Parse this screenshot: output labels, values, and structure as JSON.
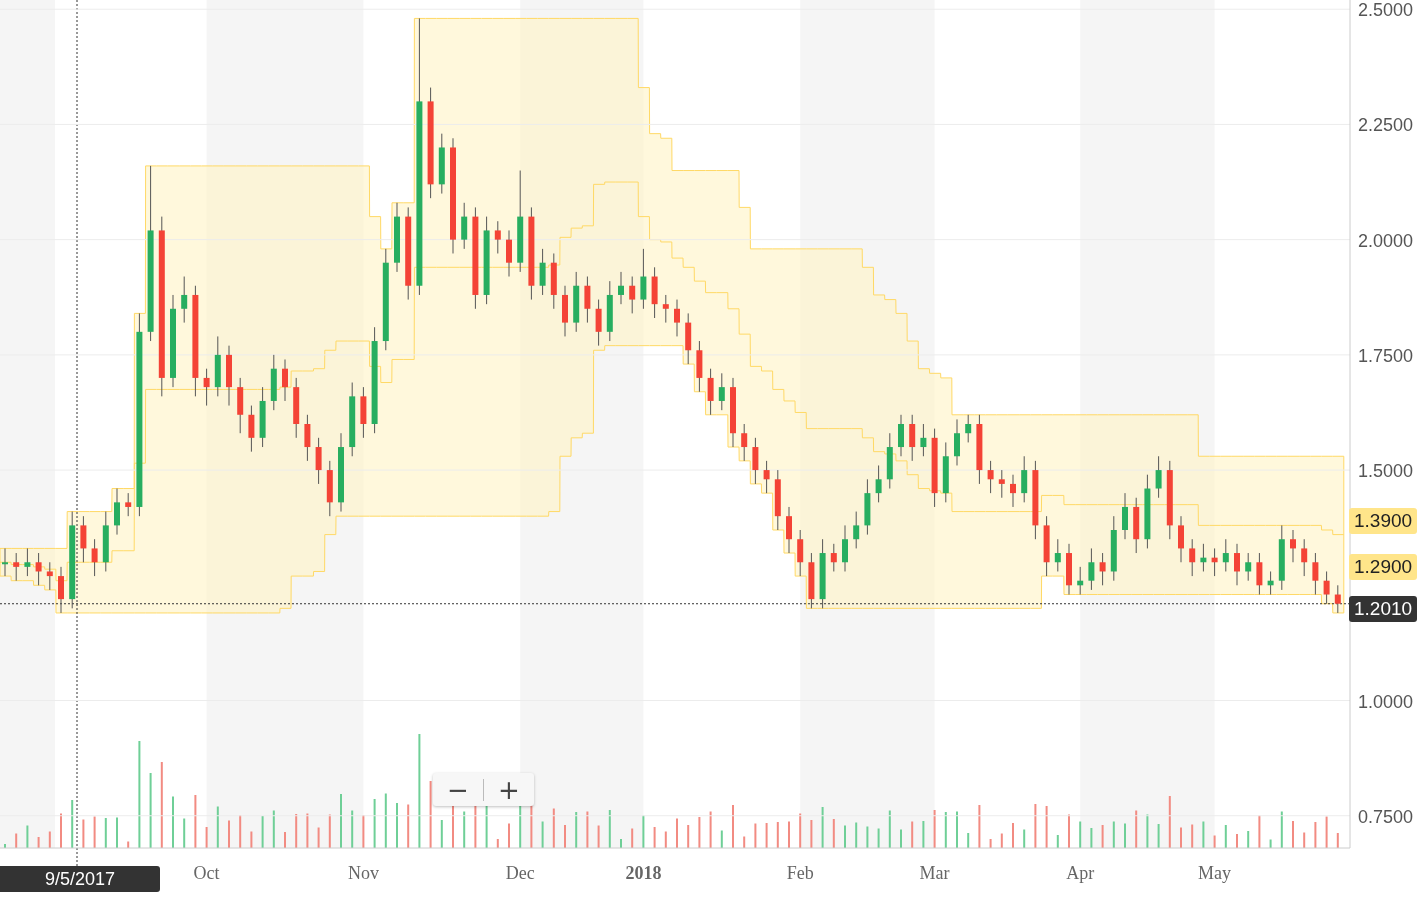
{
  "chart": {
    "chart_data": {
      "type": "candlestick",
      "ylim": [
        0.68,
        2.52
      ],
      "grid": true,
      "yticks": [
        {
          "value": 0.75,
          "label": "0.7500"
        },
        {
          "value": 1.0,
          "label": "1.0000"
        },
        {
          "value": 1.5,
          "label": "1.5000"
        },
        {
          "value": 1.75,
          "label": "1.7500"
        },
        {
          "value": 2.0,
          "label": "2.0000"
        },
        {
          "value": 2.25,
          "label": "2.2500"
        },
        {
          "value": 2.5,
          "label": "2.5000"
        }
      ],
      "categories": [
        null,
        null,
        null,
        null,
        null,
        null,
        null,
        null,
        null,
        null,
        null,
        null,
        null,
        null,
        null,
        null,
        null,
        null,
        "Oct",
        null,
        null,
        null,
        null,
        null,
        null,
        null,
        null,
        null,
        null,
        null,
        null,
        null,
        "Nov",
        null,
        null,
        null,
        null,
        null,
        null,
        null,
        null,
        null,
        null,
        null,
        null,
        null,
        "Dec",
        null,
        null,
        null,
        null,
        null,
        null,
        null,
        null,
        null,
        null,
        "2018",
        null,
        null,
        null,
        null,
        null,
        null,
        null,
        null,
        null,
        null,
        null,
        null,
        null,
        "Feb",
        null,
        null,
        null,
        null,
        null,
        null,
        null,
        null,
        null,
        null,
        null,
        "Mar",
        null,
        null,
        null,
        null,
        null,
        null,
        null,
        null,
        null,
        null,
        null,
        null,
        "Apr",
        null,
        null,
        null,
        null,
        null,
        null,
        null,
        null,
        null,
        null,
        null,
        "May",
        null,
        null,
        null,
        null,
        null,
        null,
        null,
        null,
        null,
        null,
        null
      ],
      "ohlc": [
        [
          1.3,
          1.33,
          1.27,
          1.3
        ],
        [
          1.3,
          1.32,
          1.26,
          1.29
        ],
        [
          1.29,
          1.33,
          1.27,
          1.3
        ],
        [
          1.3,
          1.32,
          1.25,
          1.28
        ],
        [
          1.28,
          1.3,
          1.24,
          1.27
        ],
        [
          1.27,
          1.29,
          1.19,
          1.22
        ],
        [
          1.22,
          1.41,
          1.2,
          1.38
        ],
        [
          1.38,
          1.4,
          1.3,
          1.33
        ],
        [
          1.33,
          1.35,
          1.27,
          1.3
        ],
        [
          1.3,
          1.41,
          1.28,
          1.38
        ],
        [
          1.38,
          1.46,
          1.36,
          1.43
        ],
        [
          1.43,
          1.45,
          1.4,
          1.42
        ],
        [
          1.42,
          1.84,
          1.4,
          1.8
        ],
        [
          1.8,
          2.16,
          1.78,
          2.02
        ],
        [
          2.02,
          2.05,
          1.66,
          1.7
        ],
        [
          1.7,
          1.88,
          1.68,
          1.85
        ],
        [
          1.85,
          1.92,
          1.82,
          1.88
        ],
        [
          1.88,
          1.9,
          1.66,
          1.7
        ],
        [
          1.7,
          1.72,
          1.64,
          1.68
        ],
        [
          1.68,
          1.79,
          1.66,
          1.75
        ],
        [
          1.75,
          1.77,
          1.64,
          1.68
        ],
        [
          1.68,
          1.7,
          1.58,
          1.62
        ],
        [
          1.62,
          1.64,
          1.54,
          1.57
        ],
        [
          1.57,
          1.68,
          1.55,
          1.65
        ],
        [
          1.65,
          1.75,
          1.63,
          1.72
        ],
        [
          1.72,
          1.74,
          1.65,
          1.68
        ],
        [
          1.68,
          1.7,
          1.57,
          1.6
        ],
        [
          1.6,
          1.62,
          1.52,
          1.55
        ],
        [
          1.55,
          1.57,
          1.47,
          1.5
        ],
        [
          1.5,
          1.52,
          1.4,
          1.43
        ],
        [
          1.43,
          1.58,
          1.41,
          1.55
        ],
        [
          1.55,
          1.69,
          1.53,
          1.66
        ],
        [
          1.66,
          1.68,
          1.57,
          1.6
        ],
        [
          1.6,
          1.81,
          1.58,
          1.78
        ],
        [
          1.78,
          1.98,
          1.76,
          1.95
        ],
        [
          1.95,
          2.08,
          1.93,
          2.05
        ],
        [
          2.05,
          2.07,
          1.87,
          1.9
        ],
        [
          1.9,
          2.48,
          1.88,
          2.3
        ],
        [
          2.3,
          2.33,
          2.09,
          2.12
        ],
        [
          2.12,
          2.23,
          2.1,
          2.2
        ],
        [
          2.2,
          2.22,
          1.97,
          2.0
        ],
        [
          2.0,
          2.08,
          1.98,
          2.05
        ],
        [
          2.05,
          2.07,
          1.85,
          1.88
        ],
        [
          1.88,
          2.05,
          1.86,
          2.02
        ],
        [
          2.02,
          2.04,
          1.97,
          2.0
        ],
        [
          2.0,
          2.02,
          1.92,
          1.95
        ],
        [
          1.95,
          2.15,
          1.93,
          2.05
        ],
        [
          2.05,
          2.07,
          1.87,
          1.9
        ],
        [
          1.9,
          1.98,
          1.88,
          1.95
        ],
        [
          1.95,
          1.97,
          1.85,
          1.88
        ],
        [
          1.88,
          1.9,
          1.79,
          1.82
        ],
        [
          1.82,
          1.93,
          1.8,
          1.9
        ],
        [
          1.9,
          1.92,
          1.82,
          1.85
        ],
        [
          1.85,
          1.87,
          1.77,
          1.8
        ],
        [
          1.8,
          1.91,
          1.78,
          1.88
        ],
        [
          1.88,
          1.93,
          1.86,
          1.9
        ],
        [
          1.9,
          1.92,
          1.84,
          1.87
        ],
        [
          1.87,
          1.98,
          1.85,
          1.92
        ],
        [
          1.92,
          1.94,
          1.83,
          1.86
        ],
        [
          1.86,
          1.88,
          1.82,
          1.85
        ],
        [
          1.85,
          1.87,
          1.79,
          1.82
        ],
        [
          1.82,
          1.84,
          1.73,
          1.76
        ],
        [
          1.76,
          1.78,
          1.67,
          1.7
        ],
        [
          1.7,
          1.72,
          1.62,
          1.65
        ],
        [
          1.65,
          1.71,
          1.63,
          1.68
        ],
        [
          1.68,
          1.7,
          1.55,
          1.58
        ],
        [
          1.58,
          1.6,
          1.52,
          1.55
        ],
        [
          1.55,
          1.57,
          1.47,
          1.5
        ],
        [
          1.5,
          1.52,
          1.45,
          1.48
        ],
        [
          1.48,
          1.5,
          1.37,
          1.4
        ],
        [
          1.4,
          1.42,
          1.32,
          1.35
        ],
        [
          1.35,
          1.37,
          1.27,
          1.3
        ],
        [
          1.3,
          1.32,
          1.2,
          1.22
        ],
        [
          1.22,
          1.35,
          1.2,
          1.32
        ],
        [
          1.32,
          1.34,
          1.28,
          1.3
        ],
        [
          1.3,
          1.38,
          1.28,
          1.35
        ],
        [
          1.35,
          1.41,
          1.33,
          1.38
        ],
        [
          1.38,
          1.48,
          1.36,
          1.45
        ],
        [
          1.45,
          1.51,
          1.43,
          1.48
        ],
        [
          1.48,
          1.58,
          1.46,
          1.55
        ],
        [
          1.55,
          1.62,
          1.53,
          1.6
        ],
        [
          1.6,
          1.62,
          1.52,
          1.55
        ],
        [
          1.55,
          1.6,
          1.53,
          1.57
        ],
        [
          1.57,
          1.59,
          1.42,
          1.45
        ],
        [
          1.45,
          1.56,
          1.43,
          1.53
        ],
        [
          1.53,
          1.61,
          1.51,
          1.58
        ],
        [
          1.58,
          1.62,
          1.56,
          1.6
        ],
        [
          1.6,
          1.62,
          1.47,
          1.5
        ],
        [
          1.5,
          1.52,
          1.45,
          1.48
        ],
        [
          1.48,
          1.5,
          1.44,
          1.47
        ],
        [
          1.47,
          1.49,
          1.42,
          1.45
        ],
        [
          1.45,
          1.53,
          1.43,
          1.5
        ],
        [
          1.5,
          1.52,
          1.35,
          1.38
        ],
        [
          1.38,
          1.4,
          1.27,
          1.3
        ],
        [
          1.3,
          1.35,
          1.28,
          1.32
        ],
        [
          1.32,
          1.34,
          1.23,
          1.25
        ],
        [
          1.25,
          1.29,
          1.23,
          1.26
        ],
        [
          1.26,
          1.33,
          1.24,
          1.3
        ],
        [
          1.3,
          1.32,
          1.25,
          1.28
        ],
        [
          1.28,
          1.4,
          1.26,
          1.37
        ],
        [
          1.37,
          1.45,
          1.35,
          1.42
        ],
        [
          1.42,
          1.44,
          1.32,
          1.35
        ],
        [
          1.35,
          1.49,
          1.33,
          1.46
        ],
        [
          1.46,
          1.53,
          1.44,
          1.5
        ],
        [
          1.5,
          1.52,
          1.35,
          1.38
        ],
        [
          1.38,
          1.4,
          1.3,
          1.33
        ],
        [
          1.33,
          1.35,
          1.27,
          1.3
        ],
        [
          1.3,
          1.34,
          1.28,
          1.31
        ],
        [
          1.31,
          1.33,
          1.27,
          1.3
        ],
        [
          1.3,
          1.35,
          1.28,
          1.32
        ],
        [
          1.32,
          1.34,
          1.25,
          1.28
        ],
        [
          1.28,
          1.32,
          1.26,
          1.3
        ],
        [
          1.3,
          1.32,
          1.23,
          1.25
        ],
        [
          1.25,
          1.28,
          1.23,
          1.26
        ],
        [
          1.26,
          1.38,
          1.24,
          1.35
        ],
        [
          1.35,
          1.37,
          1.3,
          1.33
        ],
        [
          1.33,
          1.35,
          1.27,
          1.3
        ],
        [
          1.3,
          1.32,
          1.23,
          1.26
        ],
        [
          1.26,
          1.28,
          1.21,
          1.23
        ],
        [
          1.23,
          1.25,
          1.19,
          1.21
        ]
      ]
    },
    "price_tags": [
      {
        "label": "1.3900",
        "kind": "band"
      },
      {
        "label": "1.2900",
        "kind": "band"
      },
      {
        "label": "1.2010",
        "kind": "last"
      }
    ],
    "crosshair_date": "9/5/2017",
    "zoom_controls": {
      "zoom_out": "−",
      "zoom_in": "+"
    }
  }
}
